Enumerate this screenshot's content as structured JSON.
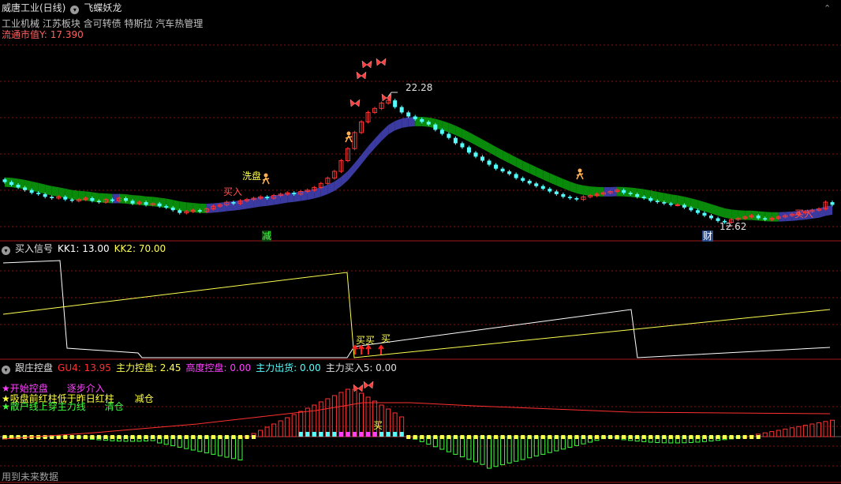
{
  "header": {
    "stock_name": "威唐工业(日线)",
    "indicator_name": "飞蝶妖龙",
    "sectors": "工业机械 江苏板块 含可转债 特斯拉 汽车热管理",
    "float_label": "流通市值Y:",
    "float_value": "17.390",
    "collapse_icon": "up-chevron-icon"
  },
  "panel2": {
    "name": "买入信号",
    "kk1": "KK1: 13.00",
    "kk2": "KK2: 70.00"
  },
  "panel3": {
    "name": "跟庄控盘",
    "gu4": "GU4: 13.95",
    "main_control": "主力控盘: 2.45",
    "high_control": "高度控盘: 0.00",
    "main_out": "主力出货: 0.00",
    "main_buy": "主力买入5: 0.00"
  },
  "legend3": [
    {
      "text": "开始控盘",
      "color": "#ff40ff"
    },
    {
      "text": "逐步介入",
      "color": "#ff40ff"
    },
    {
      "text": "吸盘前红柱低于昨日红柱",
      "color": "#ffff40"
    },
    {
      "text": "减仓",
      "color": "#ffff40"
    },
    {
      "text": "散户线上穿主力线",
      "color": "#40ff40"
    },
    {
      "text": "清仓",
      "color": "#40ff40"
    }
  ],
  "footer": "用到未来数据",
  "annotations": {
    "high_price": "22.28",
    "low_price": "12.62",
    "buy": "买入",
    "wash": "洗盘",
    "reduce": "减",
    "finance": "财",
    "buy_short": "买"
  },
  "colors": {
    "up": "#ff3232",
    "down": "#54ffff",
    "ribbon_up": "#0a8a0a",
    "ribbon_down": "#3a3aa0",
    "yellow": "#ffff50",
    "white": "#ffffff",
    "green_bar": "#40ff40",
    "grid": "#8a1010"
  },
  "chart_data": [
    {
      "type": "candlestick",
      "title": "威唐工业(日线)",
      "series": [
        {
          "name": "price",
          "x": "bar index 0-150",
          "open": [
            15.9,
            15.7,
            15.5,
            15.3,
            15.1,
            14.9,
            14.8,
            14.6,
            14.5,
            14.6,
            14.4,
            14.3,
            14.4,
            14.5,
            14.3,
            14.2,
            14.4,
            14.3,
            14.5,
            14.3,
            14.1,
            14.2,
            14.0,
            14.1,
            13.9,
            13.8,
            13.6,
            13.4,
            13.5,
            13.6,
            13.5,
            13.7,
            13.9,
            14.0,
            14.2,
            14.1,
            14.3,
            14.4,
            14.5,
            14.6,
            14.5,
            14.7,
            14.8,
            14.9,
            14.8,
            15.0,
            15.1,
            15.3,
            15.6,
            16.0,
            16.5,
            17.3,
            18.2,
            19.4,
            20.2,
            20.9,
            21.2,
            21.6,
            21.8,
            21.3,
            20.9,
            20.6,
            20.4,
            20.2,
            20.0,
            19.6,
            19.3,
            19.0,
            18.6,
            18.3,
            17.9,
            17.6,
            17.3,
            17.0,
            16.7,
            16.5,
            16.3,
            16.0,
            15.8,
            15.6,
            15.4,
            15.2,
            15.0,
            14.8,
            14.6,
            14.5,
            14.4,
            14.6,
            14.7,
            14.8,
            14.9,
            15.0,
            15.1,
            14.9,
            14.8,
            14.6,
            14.5,
            14.3,
            14.2,
            14.1,
            14.0,
            14.0,
            13.8,
            13.6,
            13.4,
            13.2,
            13.0,
            12.8,
            12.7,
            12.9,
            13.0,
            13.1,
            13.2,
            13.0,
            12.9,
            13.0,
            13.1,
            13.2,
            13.3,
            13.4,
            13.5,
            13.6,
            13.7,
            14.2
          ],
          "close": [
            15.7,
            15.5,
            15.3,
            15.1,
            14.9,
            14.8,
            14.6,
            14.5,
            14.6,
            14.4,
            14.3,
            14.4,
            14.5,
            14.3,
            14.2,
            14.4,
            14.3,
            14.5,
            14.3,
            14.1,
            14.2,
            14.0,
            14.1,
            13.9,
            13.8,
            13.6,
            13.4,
            13.5,
            13.6,
            13.5,
            13.7,
            13.9,
            14.0,
            14.2,
            14.1,
            14.3,
            14.4,
            14.5,
            14.6,
            14.5,
            14.7,
            14.8,
            14.9,
            14.8,
            15.0,
            15.1,
            15.3,
            15.6,
            16.0,
            16.5,
            17.3,
            18.2,
            19.4,
            20.2,
            20.9,
            21.2,
            21.6,
            21.8,
            21.3,
            20.9,
            20.6,
            20.4,
            20.2,
            20.0,
            19.6,
            19.3,
            19.0,
            18.6,
            18.3,
            17.9,
            17.6,
            17.3,
            17.0,
            16.7,
            16.5,
            16.3,
            16.0,
            15.8,
            15.6,
            15.4,
            15.2,
            15.0,
            14.8,
            14.6,
            14.5,
            14.4,
            14.6,
            14.7,
            14.8,
            14.9,
            15.0,
            15.1,
            14.9,
            14.8,
            14.6,
            14.5,
            14.3,
            14.2,
            14.1,
            14.0,
            14.0,
            13.8,
            13.6,
            13.4,
            13.2,
            13.0,
            12.8,
            12.7,
            12.9,
            13.0,
            13.1,
            13.2,
            13.0,
            12.9,
            13.0,
            13.1,
            13.2,
            13.3,
            13.4,
            13.5,
            13.6,
            13.7,
            14.2,
            14.0
          ]
        }
      ],
      "annotations": [
        "22.28 high",
        "12.62 low"
      ]
    }
  ]
}
